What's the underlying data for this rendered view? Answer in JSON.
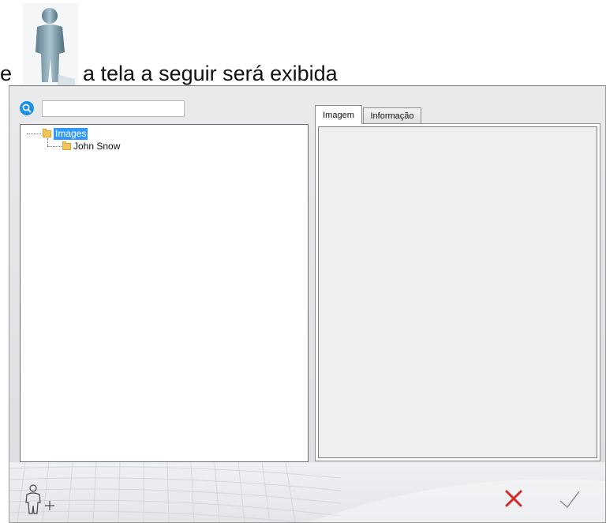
{
  "caption": {
    "prefix": "e",
    "text": "a tela a seguir será exibida",
    "figure_icon": "person-icon"
  },
  "search": {
    "icon": "search-icon",
    "value": "",
    "placeholder": ""
  },
  "tree": {
    "root": {
      "label": "Images",
      "icon": "folder-icon",
      "selected": true
    },
    "children": [
      {
        "label": "John Snow",
        "icon": "folder-icon"
      }
    ]
  },
  "tabs": [
    {
      "label": "Imagem",
      "active": true
    },
    {
      "label": "Informação",
      "active": false
    }
  ],
  "footer": {
    "add_user_icon": "add-user-icon",
    "cancel_icon": "close-icon",
    "confirm_icon": "checkmark-icon"
  },
  "colors": {
    "selection": "#3399ff",
    "cancel": "#d62a2a",
    "search_icon": "#1e90e6",
    "folder": "#f3c55b"
  }
}
